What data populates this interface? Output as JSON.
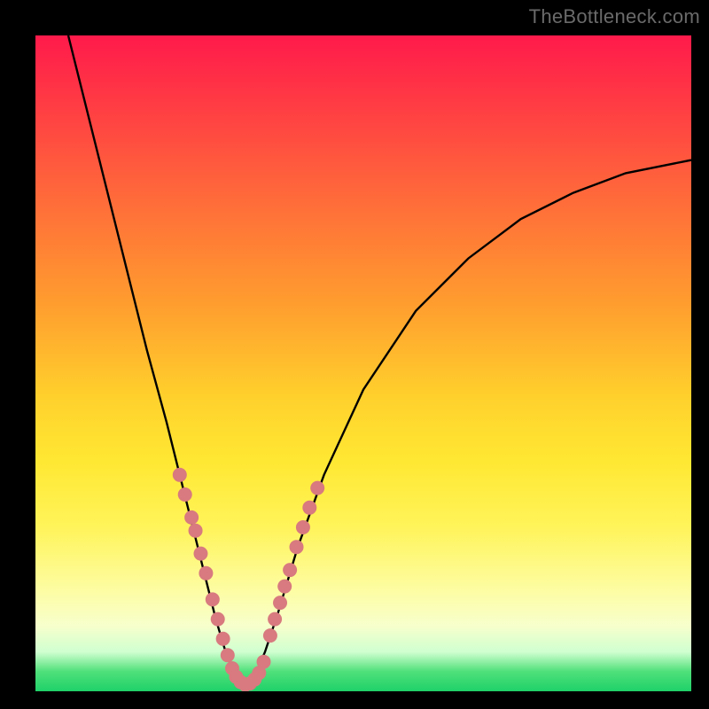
{
  "watermark": "TheBottleneck.com",
  "chart_data": {
    "type": "line",
    "title": "",
    "xlabel": "",
    "ylabel": "",
    "xlim": [
      0,
      100
    ],
    "ylim": [
      0,
      100
    ],
    "series": [
      {
        "name": "curve",
        "x": [
          5,
          8,
          11,
          14,
          17,
          20,
          22,
          24,
          26,
          27.5,
          29,
          30.5,
          32,
          33.5,
          35,
          37,
          40,
          44,
          50,
          58,
          66,
          74,
          82,
          90,
          100
        ],
        "y": [
          100,
          88,
          76,
          64,
          52,
          41,
          33,
          25,
          17,
          11,
          6,
          2.5,
          1,
          2.5,
          6,
          12,
          22,
          33,
          46,
          58,
          66,
          72,
          76,
          79,
          81
        ]
      }
    ],
    "markers": {
      "left_branch": [
        {
          "x": 22.0,
          "y": 33
        },
        {
          "x": 22.8,
          "y": 30
        },
        {
          "x": 23.8,
          "y": 26.5
        },
        {
          "x": 24.4,
          "y": 24.5
        },
        {
          "x": 25.2,
          "y": 21
        },
        {
          "x": 26.0,
          "y": 18
        },
        {
          "x": 27.0,
          "y": 14
        },
        {
          "x": 27.8,
          "y": 11
        },
        {
          "x": 28.6,
          "y": 8
        },
        {
          "x": 29.3,
          "y": 5.5
        },
        {
          "x": 30.0,
          "y": 3.5
        }
      ],
      "valley": [
        {
          "x": 30.6,
          "y": 2.2
        },
        {
          "x": 31.3,
          "y": 1.4
        },
        {
          "x": 32.0,
          "y": 1.0
        },
        {
          "x": 32.7,
          "y": 1.2
        },
        {
          "x": 33.4,
          "y": 1.8
        },
        {
          "x": 34.1,
          "y": 2.8
        }
      ],
      "right_branch": [
        {
          "x": 34.8,
          "y": 4.5
        },
        {
          "x": 35.8,
          "y": 8.5
        },
        {
          "x": 36.5,
          "y": 11
        },
        {
          "x": 37.3,
          "y": 13.5
        },
        {
          "x": 38.0,
          "y": 16
        },
        {
          "x": 38.8,
          "y": 18.5
        },
        {
          "x": 39.8,
          "y": 22
        },
        {
          "x": 40.8,
          "y": 25
        },
        {
          "x": 41.8,
          "y": 28
        },
        {
          "x": 43.0,
          "y": 31
        }
      ]
    },
    "gradient_stops": [
      {
        "pos": 0,
        "color": "#ff1a4b"
      },
      {
        "pos": 25,
        "color": "#ff6b3a"
      },
      {
        "pos": 55,
        "color": "#ffd02c"
      },
      {
        "pos": 85,
        "color": "#fdfda6"
      },
      {
        "pos": 100,
        "color": "#1fd169"
      }
    ]
  }
}
